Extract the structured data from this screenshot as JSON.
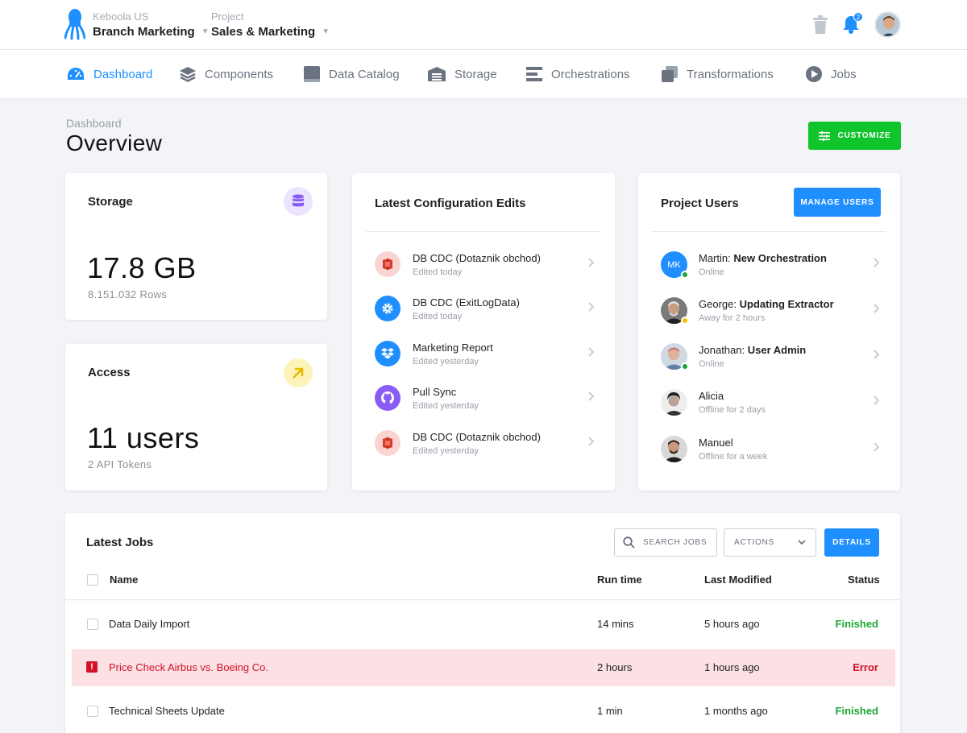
{
  "header": {
    "organization_label": "Keboola US",
    "branch": "Branch Marketing",
    "project_label": "Project",
    "project": "Sales & Marketing",
    "notifications_count": "2"
  },
  "nav": [
    {
      "label": "Dashboard",
      "icon": "dashboard-icon",
      "active": true
    },
    {
      "label": "Components",
      "icon": "layers-icon"
    },
    {
      "label": "Data Catalog",
      "icon": "book-icon"
    },
    {
      "label": "Storage",
      "icon": "warehouse-icon"
    },
    {
      "label": "Orchestrations",
      "icon": "list-icon"
    },
    {
      "label": "Transformations",
      "icon": "copy-icon"
    },
    {
      "label": "Jobs",
      "icon": "play-icon"
    }
  ],
  "page": {
    "breadcrumb": "Dashboard",
    "title": "Overview",
    "customize_label": "CUSTOMIZE"
  },
  "storage": {
    "title": "Storage",
    "value": "17.8 GB",
    "sub": "8.151.032 Rows",
    "icon": "database-icon",
    "icon_color": "#8a5cf6"
  },
  "access": {
    "title": "Access",
    "value": "11 users",
    "sub": "2 API Tokens",
    "icon": "arrow-up-right-icon",
    "icon_color": "#e6c400"
  },
  "config_edits": {
    "title": "Latest Configuration Edits",
    "items": [
      {
        "title": "DB CDC (Dotaznik obchod)",
        "sub": "Edited today",
        "icon": "db-cdc-icon",
        "color": "#f7c9c6"
      },
      {
        "title": "DB CDC (ExitLogData)",
        "sub": "Edited today",
        "icon": "gear-icon",
        "color": "#1f8fff"
      },
      {
        "title": "Marketing Report",
        "sub": "Edited yesterday",
        "icon": "dropbox-icon",
        "color": "#1f8fff"
      },
      {
        "title": "Pull Sync",
        "sub": "Edited yesterday",
        "icon": "github-icon",
        "color": "#8a5cf6"
      },
      {
        "title": "DB CDC (Dotaznik obchod)",
        "sub": "Edited yesterday",
        "icon": "db-cdc-icon",
        "color": "#f7c9c6"
      }
    ]
  },
  "project_users": {
    "title": "Project Users",
    "manage_label": "MANAGE USERS",
    "items": [
      {
        "name": "Martin:",
        "action": "New Orchestration",
        "status": "Online",
        "initials": "MK",
        "dot": "#18a831"
      },
      {
        "name": "George:",
        "action": "Updating Extractor",
        "status": "Away for 2 hours",
        "dot": "#f2c200"
      },
      {
        "name": "Jonathan:",
        "action": "User Admin",
        "status": "Online",
        "dot": "#18a831"
      },
      {
        "name": "Alicia",
        "action": "",
        "status": "Offline for 2 days"
      },
      {
        "name": "Manuel",
        "action": "",
        "status": "Offline for a week"
      }
    ]
  },
  "jobs": {
    "title": "Latest Jobs",
    "search_placeholder": "SEARCH JOBS",
    "actions_label": "ACTIONS",
    "details_label": "DETAILS",
    "columns": [
      "Name",
      "Run time",
      "Last Modified",
      "Status"
    ],
    "rows": [
      {
        "name": "Data Daily Import",
        "runtime": "14 mins",
        "modified": "5 hours ago",
        "status": "Finished",
        "error": false
      },
      {
        "name": "Price Check Airbus vs. Boeing Co.",
        "runtime": "2 hours",
        "modified": "1 hours ago",
        "status": "Error",
        "error": true
      },
      {
        "name": "Technical Sheets Update",
        "runtime": "1 min",
        "modified": "1 months ago",
        "status": "Finished",
        "error": false
      }
    ]
  }
}
